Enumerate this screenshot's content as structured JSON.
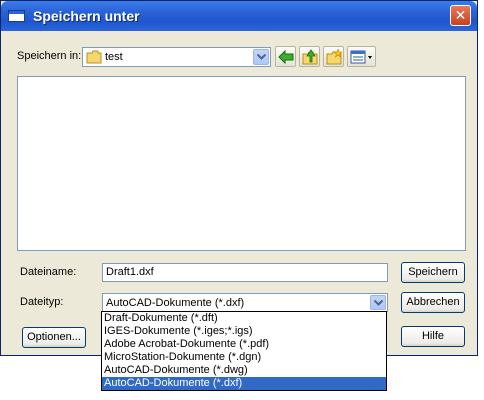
{
  "window": {
    "title": "Speichern unter",
    "close_glyph": "✕"
  },
  "save_in": {
    "label": "Speichern in:",
    "value": "test",
    "icon": "folder-icon"
  },
  "toolbar": [
    {
      "name": "back-button",
      "icon": "green-arrow-left-icon"
    },
    {
      "name": "up-folder-button",
      "icon": "folder-up-icon"
    },
    {
      "name": "new-folder-button",
      "icon": "new-folder-icon"
    },
    {
      "name": "view-menu-button",
      "icon": "view-list-icon"
    }
  ],
  "filename": {
    "label": "Dateiname:",
    "value": "Draft1.dxf"
  },
  "filetype": {
    "label": "Dateityp:",
    "value": "AutoCAD-Dokumente (*.dxf)",
    "options": [
      "Draft-Dokumente (*.dft)",
      "IGES-Dokumente (*.iges;*.igs)",
      "Adobe Acrobat-Dokumente (*.pdf)",
      "MicroStation-Dokumente (*.dgn)",
      "AutoCAD-Dokumente (*.dwg)",
      "AutoCAD-Dokumente (*.dxf)"
    ],
    "selected_index": 5
  },
  "buttons": {
    "save": "Speichern",
    "cancel": "Abbrechen",
    "options": "Optionen...",
    "help": "Hilfe"
  },
  "colors": {
    "title_bar": "#2b63d6",
    "selection": "#316ac5",
    "dialog_bg": "#ece9d8"
  }
}
